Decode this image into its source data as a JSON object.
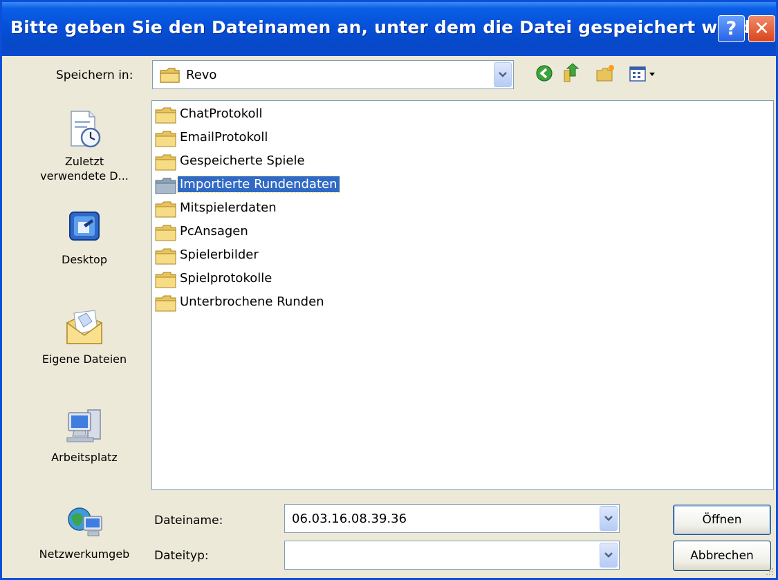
{
  "window": {
    "title": "Bitte geben Sie den Dateinamen an, unter dem die Datei gespeichert werden s...",
    "help_label": "?",
    "close_label": "✕"
  },
  "location": {
    "label": "Speichern in:",
    "value": "Revo"
  },
  "toolbar": {
    "icons": [
      "back-icon",
      "up-folder-icon",
      "new-folder-icon",
      "view-menu-icon"
    ]
  },
  "places": {
    "items": [
      {
        "label": "Zuletzt verwendete D...",
        "icon": "recent-documents-icon"
      },
      {
        "label": "Desktop",
        "icon": "desktop-icon"
      },
      {
        "label": "Eigene Dateien",
        "icon": "my-documents-icon"
      },
      {
        "label": "Arbeitsplatz",
        "icon": "my-computer-icon"
      },
      {
        "label": "Netzwerkumgeb",
        "icon": "network-icon"
      }
    ]
  },
  "files": {
    "items": [
      "ChatProtokoll",
      "EmailProtokoll",
      "Gespeicherte Spiele",
      "Importierte Rundendaten",
      "Mitspielerdaten",
      "PcAnsagen",
      "Spielerbilder",
      "Spielprotokolle",
      "Unterbrochene Runden"
    ],
    "selected": "Importierte Rundendaten"
  },
  "filename": {
    "label": "Dateiname:",
    "value": "06.03.16.08.39.36"
  },
  "filetype": {
    "label": "Dateityp:",
    "value": ""
  },
  "buttons": {
    "open": "Öffnen",
    "cancel": "Abbrechen"
  },
  "colors": {
    "titlebar": "#0650d9",
    "selection": "#316ac5",
    "dialog_bg": "#ece9d8"
  }
}
